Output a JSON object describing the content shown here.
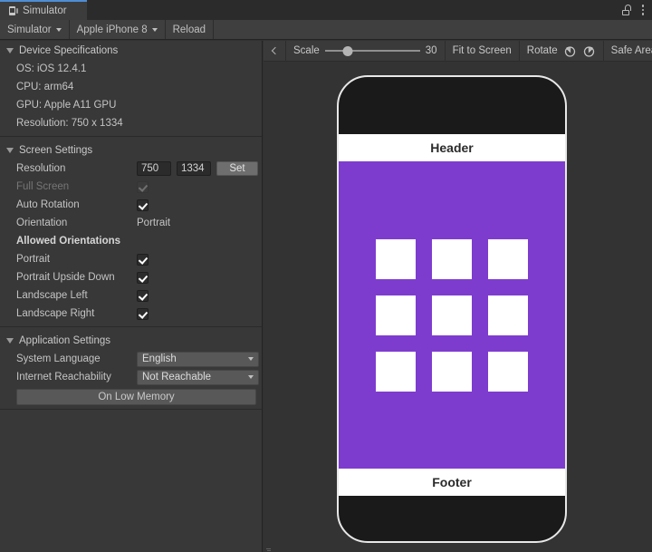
{
  "window": {
    "tab_label": "Simulator",
    "tab_icon": "device-simulator-icon",
    "lock_icon": "lock-icon",
    "menu_icon": "kebab-menu-icon"
  },
  "toolbar": {
    "simulator_menu": "Simulator",
    "device_menu": "Apple iPhone 8",
    "reload_button": "Reload"
  },
  "view_toolbar": {
    "collapse_icon": "chevron-left-icon",
    "scale_label": "Scale",
    "scale_value": "30",
    "fit_to_screen": "Fit to Screen",
    "rotate_label": "Rotate",
    "rotate_ccw_icon": "rotate-counterclockwise-icon",
    "rotate_cw_icon": "rotate-clockwise-icon",
    "safe_area": "Safe Area"
  },
  "device_specs": {
    "title": "Device Specifications",
    "os": "OS: iOS 12.4.1",
    "cpu": "CPU: arm64",
    "gpu": "GPU: Apple A11 GPU",
    "resolution": "Resolution: 750 x 1334"
  },
  "screen_settings": {
    "title": "Screen Settings",
    "resolution_label": "Resolution",
    "resolution_width": "750",
    "resolution_height": "1334",
    "set_button": "Set",
    "full_screen_label": "Full Screen",
    "full_screen_checked": true,
    "auto_rotation_label": "Auto Rotation",
    "auto_rotation_checked": true,
    "orientation_label": "Orientation",
    "orientation_value": "Portrait",
    "allowed_orientations_label": "Allowed Orientations",
    "orientations": [
      {
        "label": "Portrait",
        "checked": true
      },
      {
        "label": "Portrait Upside Down",
        "checked": true
      },
      {
        "label": "Landscape Left",
        "checked": true
      },
      {
        "label": "Landscape Right",
        "checked": true
      }
    ]
  },
  "application_settings": {
    "title": "Application Settings",
    "system_language_label": "System Language",
    "system_language_value": "English",
    "internet_reachability_label": "Internet Reachability",
    "internet_reachability_value": "Not Reachable",
    "on_low_memory_button": "On Low Memory"
  },
  "device_preview": {
    "header_text": "Header",
    "footer_text": "Footer",
    "content_color": "#7e3cce",
    "cell_color": "#ffffff",
    "frame_color": "#1a1a1a",
    "grid_cells": 9
  }
}
